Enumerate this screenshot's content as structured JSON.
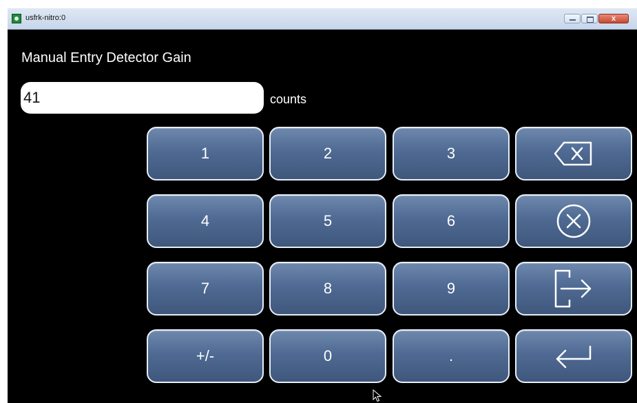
{
  "window": {
    "title": "usfrk-nitro:0",
    "close_label": "x"
  },
  "form": {
    "heading": "Manual Entry Detector Gain",
    "value": "41",
    "unit": "counts"
  },
  "keypad": {
    "keys": [
      "1",
      "2",
      "3",
      "4",
      "5",
      "6",
      "7",
      "8",
      "9",
      "+/-",
      "0",
      "."
    ]
  },
  "action_icons": [
    "backspace-icon",
    "clear-icon",
    "exit-icon",
    "enter-icon"
  ]
}
